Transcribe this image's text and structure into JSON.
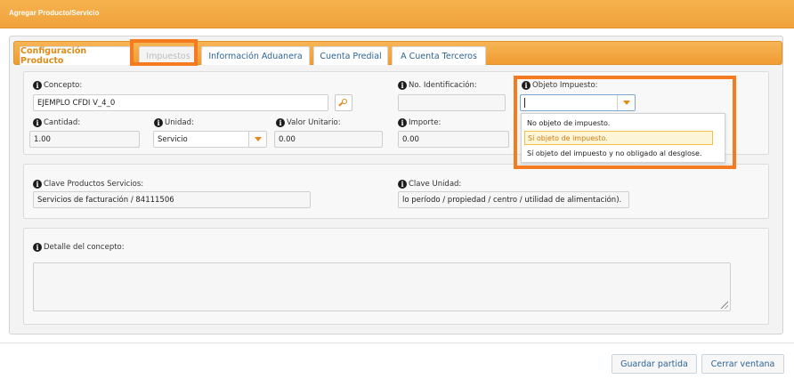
{
  "window": {
    "title": "Agregar Producto/Servicio"
  },
  "tabs": [
    {
      "label": "Configuración Producto"
    },
    {
      "label": "Impuestos"
    },
    {
      "label": "Información Aduanera"
    },
    {
      "label": "Cuenta Predial"
    },
    {
      "label": "A Cuenta Terceros"
    }
  ],
  "fields": {
    "concepto": {
      "label": "Concepto:",
      "value": "EJEMPLO CFDI V_4_0"
    },
    "no_identificacion": {
      "label": "No. Identificación:",
      "value": ""
    },
    "objeto_impuesto": {
      "label": "Objeto Impuesto:",
      "value": ""
    },
    "cantidad": {
      "label": "Cantidad:",
      "value": "1.00"
    },
    "unidad": {
      "label": "Unidad:",
      "value": "Servicio"
    },
    "valor_unitario": {
      "label": "Valor Unitario:",
      "value": "0.00"
    },
    "importe": {
      "label": "Importe:",
      "value": "0.00"
    },
    "clave_productos": {
      "label": "Clave Productos Servicios:",
      "value": "Servicios de facturación / 84111506"
    },
    "clave_unidad": {
      "label": "Clave Unidad:",
      "value": "lo período / propiedad / centro / utilidad de alimentación)."
    },
    "detalle": {
      "label": "Detalle del concepto:",
      "value": ""
    }
  },
  "dropdown": {
    "options": [
      "No objeto de impuesto.",
      "Sí objeto de impuesto.",
      "Sí objeto del impuesto y no obligado al desglose."
    ],
    "highlighted_index": 1
  },
  "buttons": {
    "save": "Guardar partida",
    "close": "Cerrar ventana"
  },
  "colors": {
    "accent": "#f0a23c",
    "highlight": "#f47b20",
    "link": "#2c6494"
  }
}
